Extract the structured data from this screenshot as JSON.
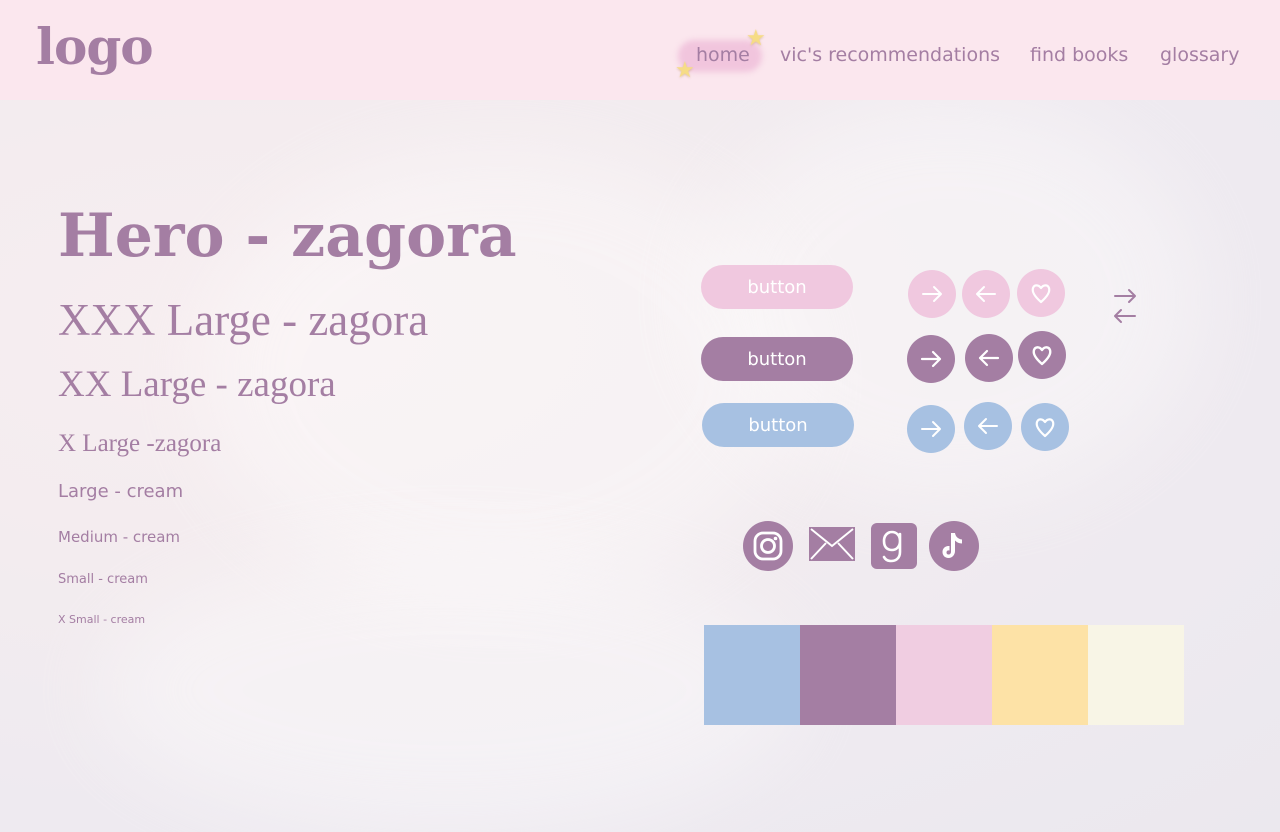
{
  "header": {
    "logo": "logo",
    "nav": [
      {
        "label": "home"
      },
      {
        "label": "vic's recommendations"
      },
      {
        "label": "find books"
      },
      {
        "label": "glossary"
      }
    ]
  },
  "typography": {
    "hero": "Hero - zagora",
    "xxx_large": "XXX Large - zagora",
    "xx_large": "XX Large - zagora",
    "x_large": "X Large -zagora",
    "large": "Large - cream",
    "medium": "Medium - cream",
    "small": "Small - cream",
    "x_small": "X Small - cream"
  },
  "buttons": [
    {
      "label": "button",
      "color": "#f0c8df"
    },
    {
      "label": "button",
      "color": "#a47ea3"
    },
    {
      "label": "button",
      "color": "#a7c1e2"
    }
  ],
  "icon_buttons": [
    {
      "row": "pink",
      "icons": [
        "arrow-right-icon",
        "arrow-left-icon",
        "heart-icon"
      ]
    },
    {
      "row": "purple",
      "icons": [
        "arrow-right-icon",
        "arrow-left-icon",
        "heart-icon"
      ]
    },
    {
      "row": "blue",
      "icons": [
        "arrow-right-icon",
        "arrow-left-icon",
        "heart-icon"
      ]
    }
  ],
  "social_icons": [
    "instagram-icon",
    "mail-icon",
    "goodreads-icon",
    "tiktok-icon"
  ],
  "palette": [
    "#a7c1e2",
    "#a47ea3",
    "#f0cde1",
    "#fde2a6",
    "#f8f5e6"
  ],
  "colors": {
    "primary": "#a47ea3",
    "pink": "#f0c8df",
    "blue": "#a7c1e2",
    "header_bg": "#fbe7ee",
    "star": "#f6dc86"
  }
}
